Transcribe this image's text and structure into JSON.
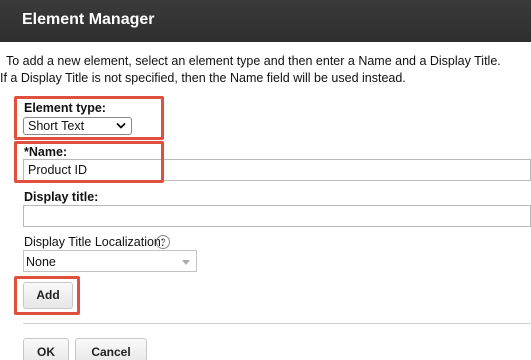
{
  "header": {
    "title": "Element Manager"
  },
  "intro": {
    "line1": "To add a new element, select an element type and then enter a Name and a Display Title.",
    "line2": "If a Display Title is not specified, then the Name field will be used instead."
  },
  "element_type": {
    "label": "Element type:",
    "selected": "Short Text",
    "chevron_icon": "chevron-down-icon"
  },
  "name": {
    "label": "*Name:",
    "value": "Product ID"
  },
  "display_title": {
    "label": "Display title:",
    "value": ""
  },
  "localization": {
    "label": "Display Title Localization:",
    "help_icon": "question-circle-icon",
    "help_glyph": "?",
    "selected": "None"
  },
  "buttons": {
    "add": "Add",
    "ok": "OK",
    "cancel": "Cancel"
  },
  "colors": {
    "header_bg": "#333333",
    "highlight": "#e0503e"
  }
}
